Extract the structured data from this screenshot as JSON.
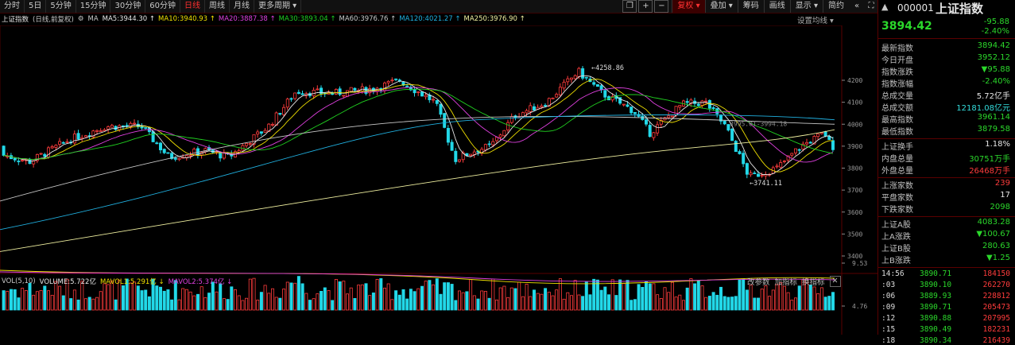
{
  "toolbar": {
    "periods": [
      "分时",
      "5日",
      "5分钟",
      "15分钟",
      "30分钟",
      "60分钟",
      "日线",
      "周线",
      "月线",
      "更多周期 ▾"
    ],
    "active_period": "日线",
    "tools": [
      "复权 ▾",
      "叠加 ▾",
      "筹码",
      "画线",
      "显示 ▾",
      "简约"
    ],
    "icons": [
      "copy-icon",
      "plus-icon",
      "minus-icon"
    ]
  },
  "ma_info": {
    "title": "上证指数",
    "mode": "(日线,前复权)",
    "items": [
      {
        "label": "MA5:3944.30",
        "color": "#e8e8e8"
      },
      {
        "label": "MA10:3940.93",
        "color": "#f0e000"
      },
      {
        "label": "MA20:3887.38",
        "color": "#e040e0"
      },
      {
        "label": "MA30:3893.04",
        "color": "#20d020"
      },
      {
        "label": "MA60:3976.76",
        "color": "#c8c8c8"
      },
      {
        "label": "MA120:4021.27",
        "color": "#20b0e0"
      },
      {
        "label": "MA250:3976.90",
        "color": "#f0f0a0"
      }
    ],
    "settings": "设置均线 ▾"
  },
  "chart_data": {
    "type": "candlestick",
    "y_ticks": [
      4200,
      4100,
      4000,
      3900,
      3800,
      3700,
      3600,
      3500,
      3400
    ],
    "annotations": [
      "4258.86",
      "3741.11",
      "3995.01-3994.18"
    ],
    "vol_ticks": [
      "9.53",
      "4.76"
    ]
  },
  "volume": {
    "label": "VOL(5,10)",
    "items": [
      {
        "label": "VOLUME:5.722亿",
        "color": "#e8e8e8"
      },
      {
        "label": "MAVOL1:5.291亿",
        "color": "#f0e000"
      },
      {
        "label": "MAVOL2:5.374亿",
        "color": "#e040e0"
      }
    ],
    "tools": [
      "改参数",
      "加指标",
      "换指标"
    ]
  },
  "quote": {
    "code": "000001",
    "name": "上证指数",
    "price": "3894.42",
    "change": "-95.88",
    "pct": "-2.40%",
    "stats": [
      {
        "label": "最新指数",
        "value": "3894.42",
        "c": "green"
      },
      {
        "label": "今日开盘",
        "value": "3952.12",
        "c": "green"
      },
      {
        "label": "指数涨跌",
        "value": "▼95.88",
        "c": "green"
      },
      {
        "label": "指数涨幅",
        "value": "-2.40%",
        "c": "green"
      },
      {
        "label": "总成交量",
        "value": "5.72亿手",
        "c": "white"
      },
      {
        "label": "总成交额",
        "value": "12181.08亿元",
        "c": "cyan"
      },
      {
        "label": "最高指数",
        "value": "3961.14",
        "c": "green"
      },
      {
        "label": "最低指数",
        "value": "3879.58",
        "c": "green"
      }
    ],
    "stats2": [
      {
        "label": "上证换手",
        "value": "1.18%",
        "c": "white"
      },
      {
        "label": "内盘总量",
        "value": "30751万手",
        "c": "green"
      },
      {
        "label": "外盘总量",
        "value": "26468万手",
        "c": "red"
      }
    ],
    "stats3": [
      {
        "label": "上涨家数",
        "value": "239",
        "c": "red"
      },
      {
        "label": "平盘家数",
        "value": "17",
        "c": "white"
      },
      {
        "label": "下跌家数",
        "value": "2098",
        "c": "green"
      }
    ],
    "stats4": [
      {
        "label": "上证A股",
        "value": "4083.28",
        "c": "green"
      },
      {
        "label": "上A涨跌",
        "value": "▼100.67",
        "c": "green"
      },
      {
        "label": "上证B股",
        "value": "280.63",
        "c": "green"
      },
      {
        "label": "上B涨跌",
        "value": "▼1.25",
        "c": "green"
      }
    ],
    "ticks": [
      {
        "t": "14:56",
        "p": "3890.71",
        "v": "184150"
      },
      {
        "t": ":03",
        "p": "3890.10",
        "v": "262270"
      },
      {
        "t": ":06",
        "p": "3889.93",
        "v": "228812"
      },
      {
        "t": ":09",
        "p": "3890.71",
        "v": "205473"
      },
      {
        "t": ":12",
        "p": "3890.88",
        "v": "207995"
      },
      {
        "t": ":15",
        "p": "3890.49",
        "v": "182231"
      },
      {
        "t": ":18",
        "p": "3890.34",
        "v": "216439"
      }
    ]
  }
}
